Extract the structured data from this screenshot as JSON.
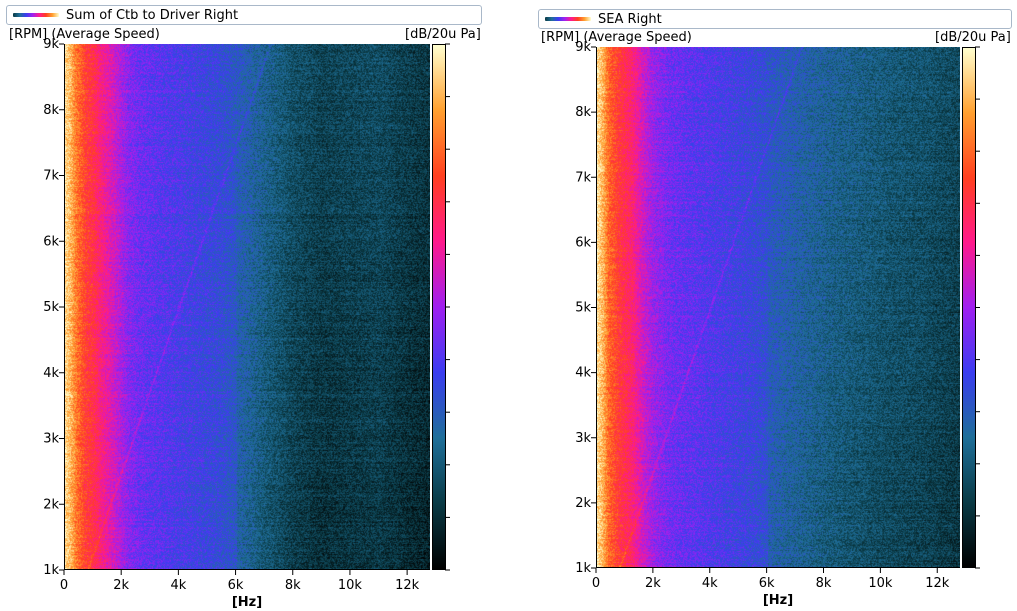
{
  "chart_data": [
    {
      "type": "heatmap",
      "legend": "Sum of Ctb to Driver Right",
      "ylabel": "[RPM] (Average Speed)",
      "zlabel": "[dB/20u Pa]",
      "xlabel": "[Hz]",
      "xlim": [
        0,
        12800
      ],
      "ylim": [
        1000,
        9000
      ],
      "xticks": [
        0,
        2000,
        4000,
        6000,
        8000,
        10000,
        12000
      ],
      "xtick_labels": [
        "0",
        "2k",
        "4k",
        "6k",
        "8k",
        "10k",
        "12k"
      ],
      "yticks": [
        1000,
        2000,
        3000,
        4000,
        5000,
        6000,
        7000,
        8000,
        9000
      ],
      "ytick_labels": [
        "1k",
        "2k",
        "3k",
        "4k",
        "5k",
        "6k",
        "7k",
        "8k",
        "9k"
      ],
      "colormap": [
        "#000000",
        "#0a3a45",
        "#1f6f99",
        "#3b3df0",
        "#a020f0",
        "#ff1a8c",
        "#ff4020",
        "#ffa030",
        "#ffffd0"
      ],
      "level_profile": [
        [
          0,
          0.95
        ],
        [
          200,
          0.9
        ],
        [
          400,
          0.82
        ],
        [
          700,
          0.74
        ],
        [
          1000,
          0.7
        ],
        [
          1300,
          0.63
        ],
        [
          1700,
          0.56
        ],
        [
          2200,
          0.47
        ],
        [
          2700,
          0.43
        ],
        [
          3500,
          0.4
        ],
        [
          4500,
          0.37
        ],
        [
          5500,
          0.34
        ],
        [
          6200,
          0.3
        ],
        [
          7000,
          0.24
        ],
        [
          8000,
          0.18
        ],
        [
          9000,
          0.15
        ],
        [
          10000,
          0.16
        ],
        [
          11000,
          0.17
        ],
        [
          12000,
          0.14
        ],
        [
          12800,
          0.12
        ]
      ],
      "order_line": {
        "x_at_min_rpm": 800,
        "x_at_max_rpm": 7200
      }
    },
    {
      "type": "heatmap",
      "legend": "SEA Right",
      "ylabel": "[RPM] (Average Speed)",
      "zlabel": "[dB/20u Pa]",
      "xlabel": "[Hz]",
      "xlim": [
        0,
        12800
      ],
      "ylim": [
        1000,
        9000
      ],
      "xticks": [
        0,
        2000,
        4000,
        6000,
        8000,
        10000,
        12000
      ],
      "xtick_labels": [
        "0",
        "2k",
        "4k",
        "6k",
        "8k",
        "10k",
        "12k"
      ],
      "yticks": [
        1000,
        2000,
        3000,
        4000,
        5000,
        6000,
        7000,
        8000,
        9000
      ],
      "ytick_labels": [
        "1k",
        "2k",
        "3k",
        "4k",
        "5k",
        "6k",
        "7k",
        "8k",
        "9k"
      ],
      "colormap": [
        "#000000",
        "#0a3a45",
        "#1f6f99",
        "#3b3df0",
        "#a020f0",
        "#ff1a8c",
        "#ff4020",
        "#ffa030",
        "#ffffd0"
      ],
      "level_profile": [
        [
          0,
          0.96
        ],
        [
          200,
          0.9
        ],
        [
          400,
          0.8
        ],
        [
          800,
          0.72
        ],
        [
          1200,
          0.66
        ],
        [
          1600,
          0.56
        ],
        [
          2000,
          0.49
        ],
        [
          2600,
          0.44
        ],
        [
          3500,
          0.41
        ],
        [
          4500,
          0.38
        ],
        [
          5500,
          0.35
        ],
        [
          6500,
          0.31
        ],
        [
          7500,
          0.27
        ],
        [
          8500,
          0.24
        ],
        [
          9500,
          0.22
        ],
        [
          10500,
          0.2
        ],
        [
          11500,
          0.19
        ],
        [
          12800,
          0.16
        ]
      ],
      "order_line": {
        "x_at_min_rpm": 800,
        "x_at_max_rpm": 7200
      }
    }
  ]
}
